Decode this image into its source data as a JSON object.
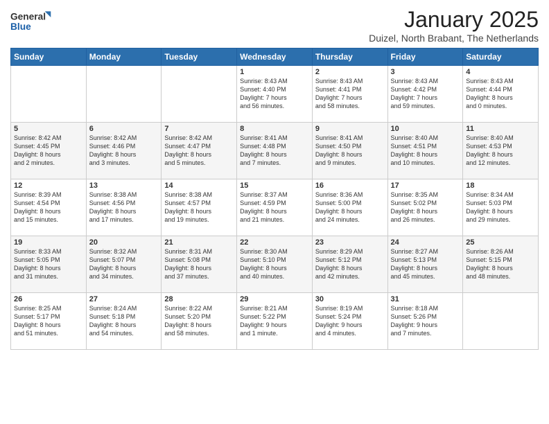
{
  "logo": {
    "line1": "General",
    "line2": "Blue"
  },
  "title": "January 2025",
  "subtitle": "Duizel, North Brabant, The Netherlands",
  "days_header": [
    "Sunday",
    "Monday",
    "Tuesday",
    "Wednesday",
    "Thursday",
    "Friday",
    "Saturday"
  ],
  "weeks": [
    [
      {
        "day": "",
        "text": ""
      },
      {
        "day": "",
        "text": ""
      },
      {
        "day": "",
        "text": ""
      },
      {
        "day": "1",
        "text": "Sunrise: 8:43 AM\nSunset: 4:40 PM\nDaylight: 7 hours\nand 56 minutes."
      },
      {
        "day": "2",
        "text": "Sunrise: 8:43 AM\nSunset: 4:41 PM\nDaylight: 7 hours\nand 58 minutes."
      },
      {
        "day": "3",
        "text": "Sunrise: 8:43 AM\nSunset: 4:42 PM\nDaylight: 7 hours\nand 59 minutes."
      },
      {
        "day": "4",
        "text": "Sunrise: 8:43 AM\nSunset: 4:44 PM\nDaylight: 8 hours\nand 0 minutes."
      }
    ],
    [
      {
        "day": "5",
        "text": "Sunrise: 8:42 AM\nSunset: 4:45 PM\nDaylight: 8 hours\nand 2 minutes."
      },
      {
        "day": "6",
        "text": "Sunrise: 8:42 AM\nSunset: 4:46 PM\nDaylight: 8 hours\nand 3 minutes."
      },
      {
        "day": "7",
        "text": "Sunrise: 8:42 AM\nSunset: 4:47 PM\nDaylight: 8 hours\nand 5 minutes."
      },
      {
        "day": "8",
        "text": "Sunrise: 8:41 AM\nSunset: 4:48 PM\nDaylight: 8 hours\nand 7 minutes."
      },
      {
        "day": "9",
        "text": "Sunrise: 8:41 AM\nSunset: 4:50 PM\nDaylight: 8 hours\nand 9 minutes."
      },
      {
        "day": "10",
        "text": "Sunrise: 8:40 AM\nSunset: 4:51 PM\nDaylight: 8 hours\nand 10 minutes."
      },
      {
        "day": "11",
        "text": "Sunrise: 8:40 AM\nSunset: 4:53 PM\nDaylight: 8 hours\nand 12 minutes."
      }
    ],
    [
      {
        "day": "12",
        "text": "Sunrise: 8:39 AM\nSunset: 4:54 PM\nDaylight: 8 hours\nand 15 minutes."
      },
      {
        "day": "13",
        "text": "Sunrise: 8:38 AM\nSunset: 4:56 PM\nDaylight: 8 hours\nand 17 minutes."
      },
      {
        "day": "14",
        "text": "Sunrise: 8:38 AM\nSunset: 4:57 PM\nDaylight: 8 hours\nand 19 minutes."
      },
      {
        "day": "15",
        "text": "Sunrise: 8:37 AM\nSunset: 4:59 PM\nDaylight: 8 hours\nand 21 minutes."
      },
      {
        "day": "16",
        "text": "Sunrise: 8:36 AM\nSunset: 5:00 PM\nDaylight: 8 hours\nand 24 minutes."
      },
      {
        "day": "17",
        "text": "Sunrise: 8:35 AM\nSunset: 5:02 PM\nDaylight: 8 hours\nand 26 minutes."
      },
      {
        "day": "18",
        "text": "Sunrise: 8:34 AM\nSunset: 5:03 PM\nDaylight: 8 hours\nand 29 minutes."
      }
    ],
    [
      {
        "day": "19",
        "text": "Sunrise: 8:33 AM\nSunset: 5:05 PM\nDaylight: 8 hours\nand 31 minutes."
      },
      {
        "day": "20",
        "text": "Sunrise: 8:32 AM\nSunset: 5:07 PM\nDaylight: 8 hours\nand 34 minutes."
      },
      {
        "day": "21",
        "text": "Sunrise: 8:31 AM\nSunset: 5:08 PM\nDaylight: 8 hours\nand 37 minutes."
      },
      {
        "day": "22",
        "text": "Sunrise: 8:30 AM\nSunset: 5:10 PM\nDaylight: 8 hours\nand 40 minutes."
      },
      {
        "day": "23",
        "text": "Sunrise: 8:29 AM\nSunset: 5:12 PM\nDaylight: 8 hours\nand 42 minutes."
      },
      {
        "day": "24",
        "text": "Sunrise: 8:27 AM\nSunset: 5:13 PM\nDaylight: 8 hours\nand 45 minutes."
      },
      {
        "day": "25",
        "text": "Sunrise: 8:26 AM\nSunset: 5:15 PM\nDaylight: 8 hours\nand 48 minutes."
      }
    ],
    [
      {
        "day": "26",
        "text": "Sunrise: 8:25 AM\nSunset: 5:17 PM\nDaylight: 8 hours\nand 51 minutes."
      },
      {
        "day": "27",
        "text": "Sunrise: 8:24 AM\nSunset: 5:18 PM\nDaylight: 8 hours\nand 54 minutes."
      },
      {
        "day": "28",
        "text": "Sunrise: 8:22 AM\nSunset: 5:20 PM\nDaylight: 8 hours\nand 58 minutes."
      },
      {
        "day": "29",
        "text": "Sunrise: 8:21 AM\nSunset: 5:22 PM\nDaylight: 9 hours\nand 1 minute."
      },
      {
        "day": "30",
        "text": "Sunrise: 8:19 AM\nSunset: 5:24 PM\nDaylight: 9 hours\nand 4 minutes."
      },
      {
        "day": "31",
        "text": "Sunrise: 8:18 AM\nSunset: 5:26 PM\nDaylight: 9 hours\nand 7 minutes."
      },
      {
        "day": "",
        "text": ""
      }
    ]
  ]
}
